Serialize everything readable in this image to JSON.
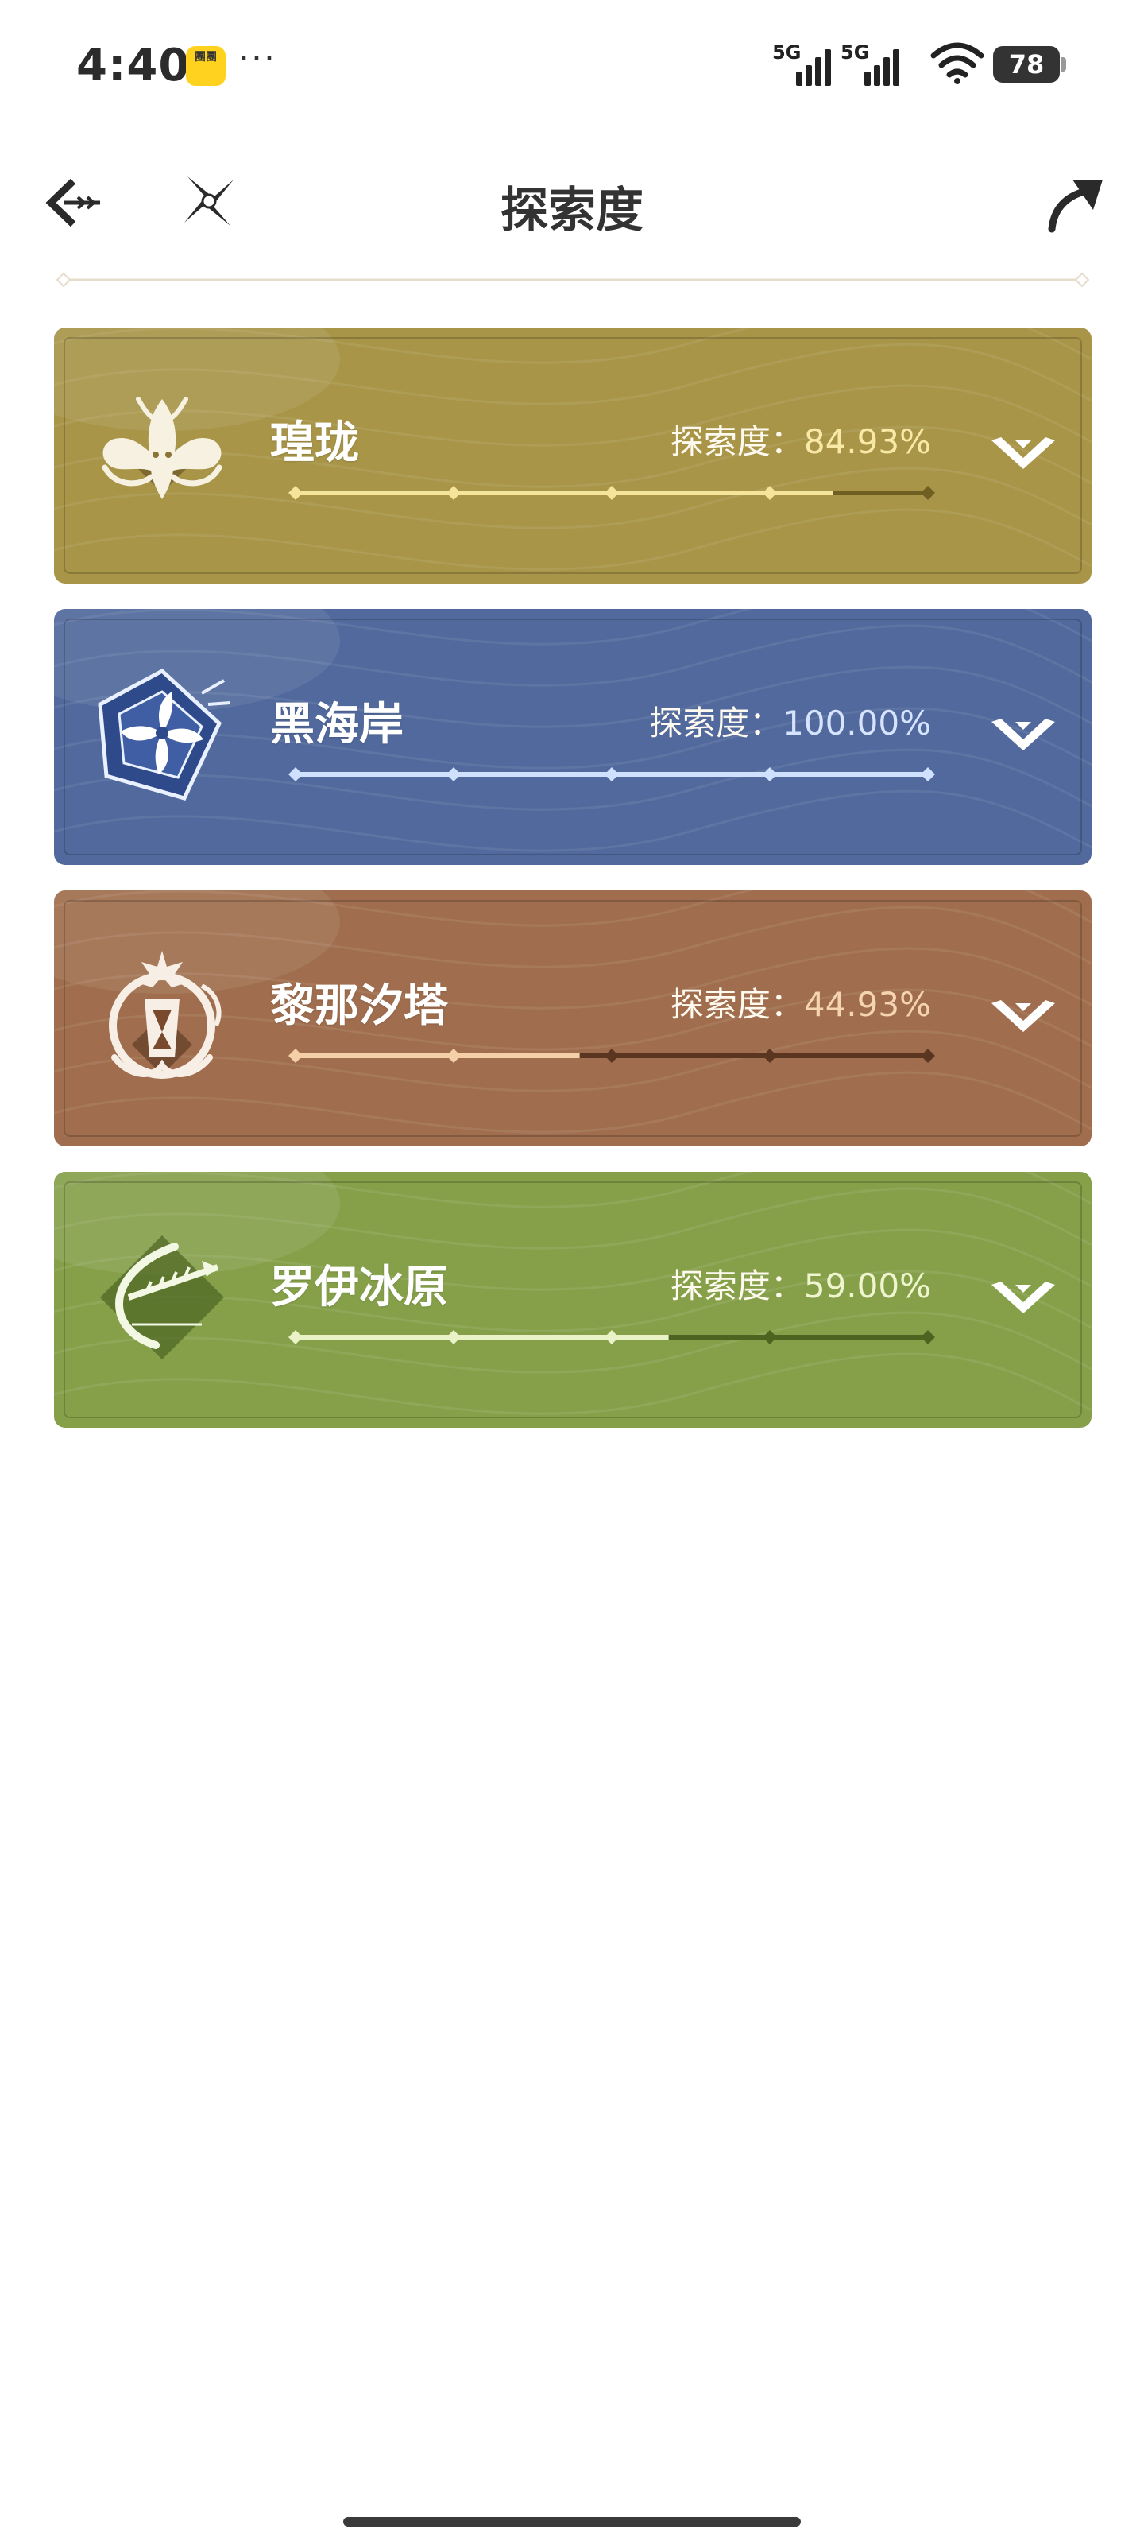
{
  "status_bar": {
    "time": "4:40",
    "app_badge": "團團",
    "more": "···",
    "signal1_label": "5G",
    "signal2_label": "5G",
    "battery": "78"
  },
  "header": {
    "title": "探索度",
    "back_icon": "back-arrow-icon",
    "compass_icon": "compass-icon",
    "share_icon": "share-icon"
  },
  "pct_label": "探索度：",
  "regions": [
    {
      "name": "瑝珑",
      "percent_text": "84.93%",
      "progress": 0.8493,
      "bg": "#a89548",
      "fill": "#f4e59a",
      "track": "#6f5f22",
      "pct_color": "#f8eaa6",
      "emblem": "dragon-emblem-icon"
    },
    {
      "name": "黑海岸",
      "percent_text": "100.00%",
      "progress": 1.0,
      "bg": "#51699c",
      "fill": "#cfe1ff",
      "track": "#2b3f6d",
      "pct_color": "#d7e4ff",
      "emblem": "star-flower-emblem-icon"
    },
    {
      "name": "黎那汐塔",
      "percent_text": "44.93%",
      "progress": 0.4493,
      "bg": "#a06e4e",
      "fill": "#f4cfa8",
      "track": "#5a3520",
      "pct_color": "#f5d4b4",
      "emblem": "lantern-emblem-icon"
    },
    {
      "name": "罗伊冰原",
      "percent_text": "59.00%",
      "progress": 0.59,
      "bg": "#86a04a",
      "fill": "#eaf2c8",
      "track": "#4d6420",
      "pct_color": "#eef5cf",
      "emblem": "ice-arrow-emblem-icon"
    }
  ]
}
